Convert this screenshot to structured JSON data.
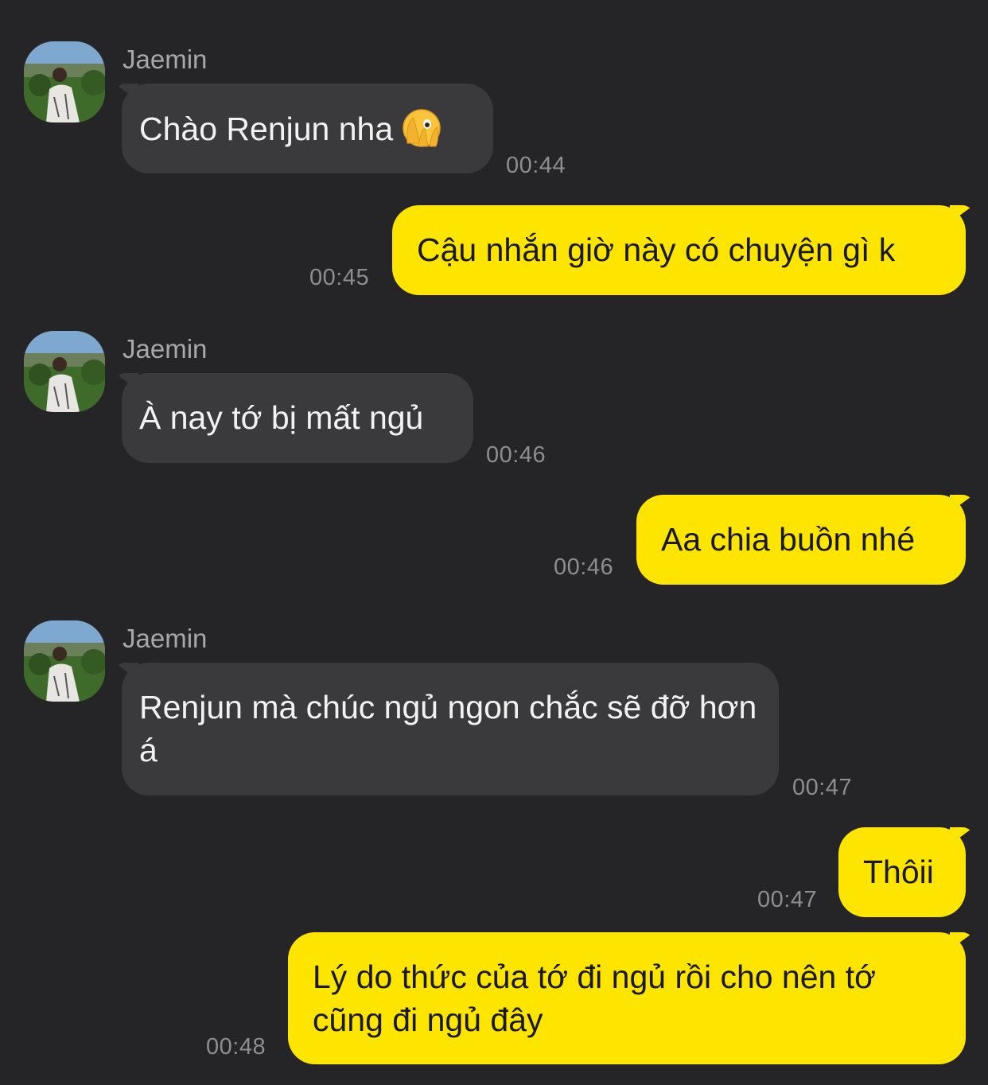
{
  "contact": {
    "name": "Jaemin"
  },
  "messages": [
    {
      "dir": "in",
      "sender": "Jaemin",
      "text": "Chào Renjun nha",
      "emoji": "face-with-peeking-eye-icon",
      "time": "00:44"
    },
    {
      "dir": "out",
      "text": "Cậu nhắn giờ này có chuyện gì k",
      "time": "00:45"
    },
    {
      "dir": "in",
      "sender": "Jaemin",
      "text": "À nay tớ bị mất ngủ",
      "time": "00:46"
    },
    {
      "dir": "out",
      "text": "Aa chia buồn nhé",
      "time": "00:46"
    },
    {
      "dir": "in",
      "sender": "Jaemin",
      "text": "Renjun mà chúc ngủ ngon chắc sẽ đỡ hơn á",
      "time": "00:47"
    },
    {
      "dir": "out",
      "text": "Thôii",
      "time": "00:47"
    },
    {
      "dir": "out",
      "text": "Lý do thức của tớ đi ngủ rồi cho nên tớ cũng đi ngủ đây",
      "time": "00:48"
    }
  ],
  "colors": {
    "background": "#252527",
    "incoming_bubble": "#3a3a3c",
    "outgoing_bubble": "#fee500"
  }
}
